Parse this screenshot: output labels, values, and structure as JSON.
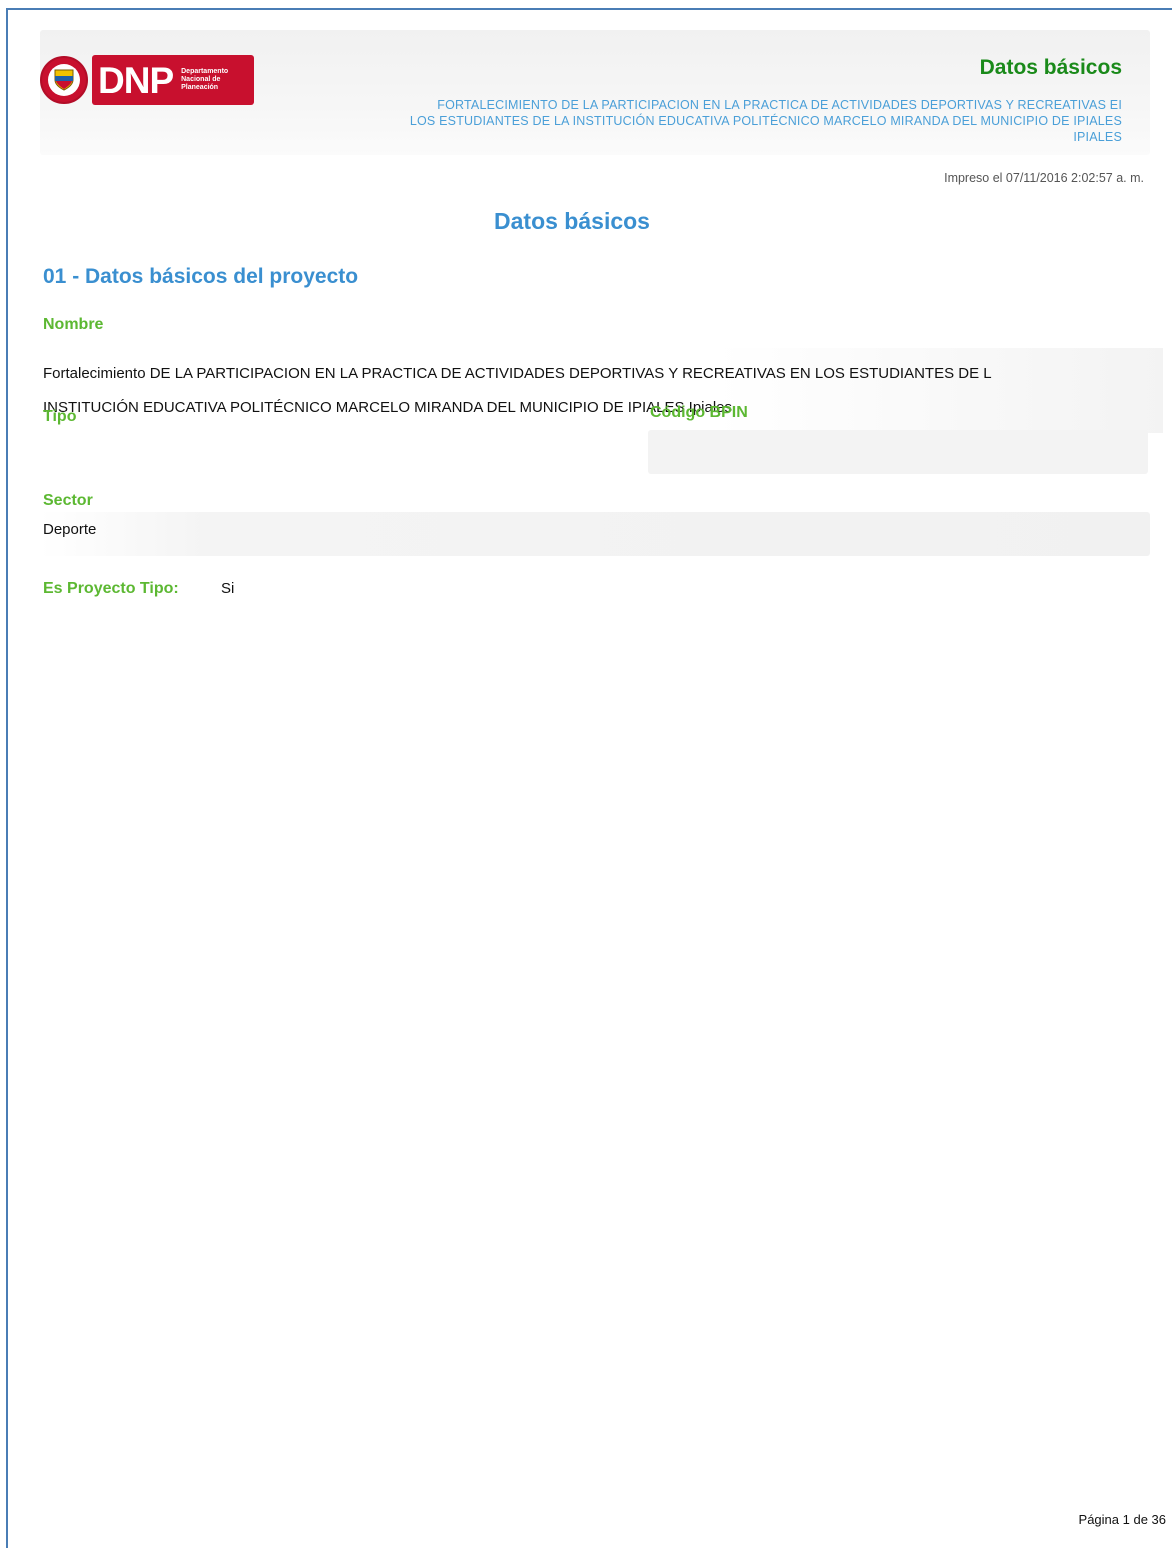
{
  "header": {
    "logo_text": "DNP",
    "logo_subtitle": "Departamento Nacional de Planeación",
    "title": "Datos básicos",
    "project_line1": "FORTALECIMIENTO DE LA PARTICIPACION EN LA PRACTICA DE ACTIVIDADES DEPORTIVAS Y RECREATIVAS EI",
    "project_line2": "LOS ESTUDIANTES DE LA INSTITUCIÓN EDUCATIVA POLITÉCNICO MARCELO MIRANDA DEL MUNICIPIO DE IPIALES",
    "project_line3": "IPIALES"
  },
  "printed_at": "Impreso el 07/11/2016 2:02:57 a. m.",
  "document_title": "Datos básicos",
  "section": {
    "title": "01 - Datos básicos del proyecto",
    "nombre_label": "Nombre",
    "nombre_line1": "Fortalecimiento DE LA PARTICIPACION EN LA PRACTICA DE ACTIVIDADES DEPORTIVAS Y RECREATIVAS EN LOS ESTUDIANTES DE L",
    "nombre_line2": "INSTITUCIÓN EDUCATIVA POLITÉCNICO MARCELO MIRANDA DEL MUNICIPIO DE IPIALES  Ipiales",
    "tipo_label": "Tipo",
    "bpin_label": "Código BPIN",
    "sector_label": "Sector",
    "sector_value": "Deporte",
    "proyecto_tipo_label": "Es Proyecto Tipo:",
    "proyecto_tipo_value": "Si"
  },
  "footer": {
    "page_number": "Página 1 de 36"
  },
  "colors": {
    "frame": "#4a7db5",
    "brand_red": "#c8102e",
    "title_green": "#1a8a1a",
    "label_green": "#5cb832",
    "heading_blue": "#3a8fd0"
  }
}
